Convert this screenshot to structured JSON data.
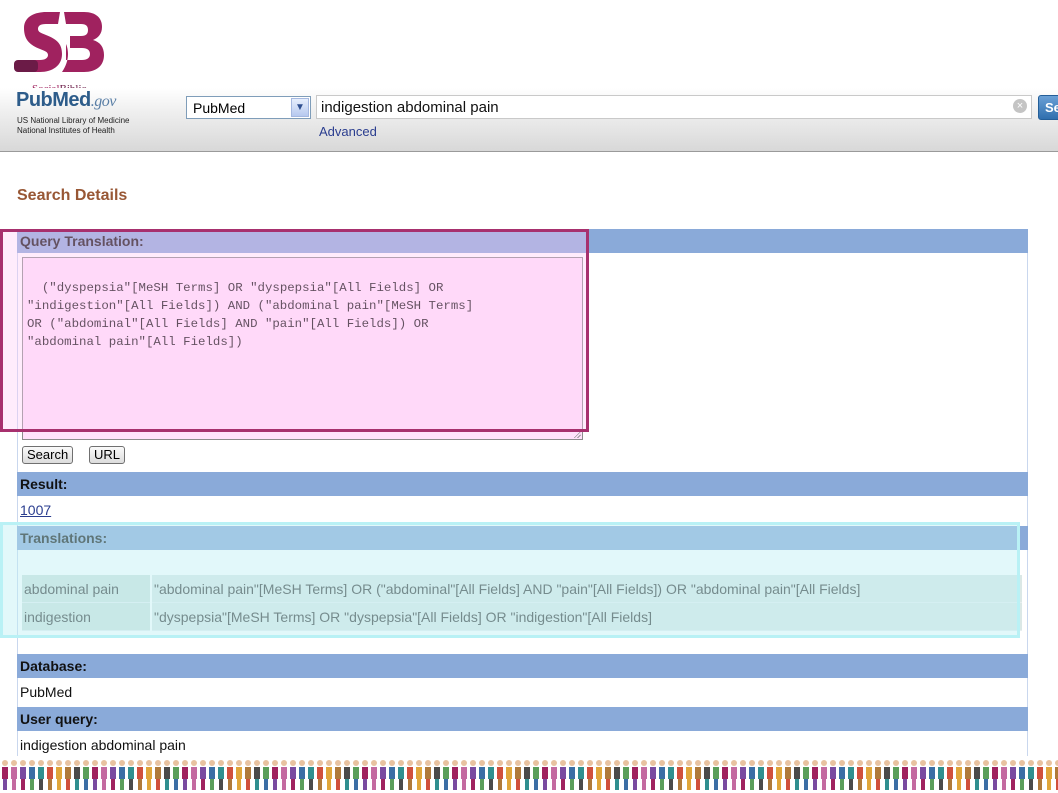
{
  "logo": {
    "prefix": "Social",
    "suffix": "Biblio",
    "colors": {
      "primary": "#a0225f",
      "dark": "#6b1b47"
    }
  },
  "header": {
    "pubmed_logo": "PubMed",
    "pubmed_suffix": ".gov",
    "nlm_line": "US National Library of Medicine\nNational Institutes of Health",
    "database_selected": "PubMed",
    "search_value": "indigestion abdominal pain",
    "search_button": "Search",
    "advanced_link": "Advanced"
  },
  "details": {
    "title": "Search Details",
    "query_translation_label": "Query Translation:",
    "query_translation": "(\"dyspepsia\"[MeSH Terms] OR \"dyspepsia\"[All Fields] OR\n\"indigestion\"[All Fields]) AND (\"abdominal pain\"[MeSH Terms]\nOR (\"abdominal\"[All Fields] AND \"pain\"[All Fields]) OR\n\"abdominal pain\"[All Fields])",
    "search_btn": "Search",
    "url_btn": "URL",
    "result_label": "Result:",
    "result_count": "1007",
    "translations_label": "Translations:",
    "translations": [
      {
        "term": "abdominal pain",
        "expansion": "\"abdominal pain\"[MeSH Terms] OR (\"abdominal\"[All Fields] AND \"pain\"[All Fields]) OR \"abdominal pain\"[All Fields]"
      },
      {
        "term": "indigestion",
        "expansion": "\"dyspepsia\"[MeSH Terms] OR \"dyspepsia\"[All Fields] OR \"indigestion\"[All Fields]"
      }
    ],
    "database_label": "Database:",
    "database_value": "PubMed",
    "user_query_label": "User query:",
    "user_query_value": "indigestion abdominal pain"
  },
  "colors": {
    "bar": "#8aaad9",
    "highlight_magenta": "#a7306e",
    "highlight_cyan": "#b9f1f5",
    "title": "#985735"
  }
}
